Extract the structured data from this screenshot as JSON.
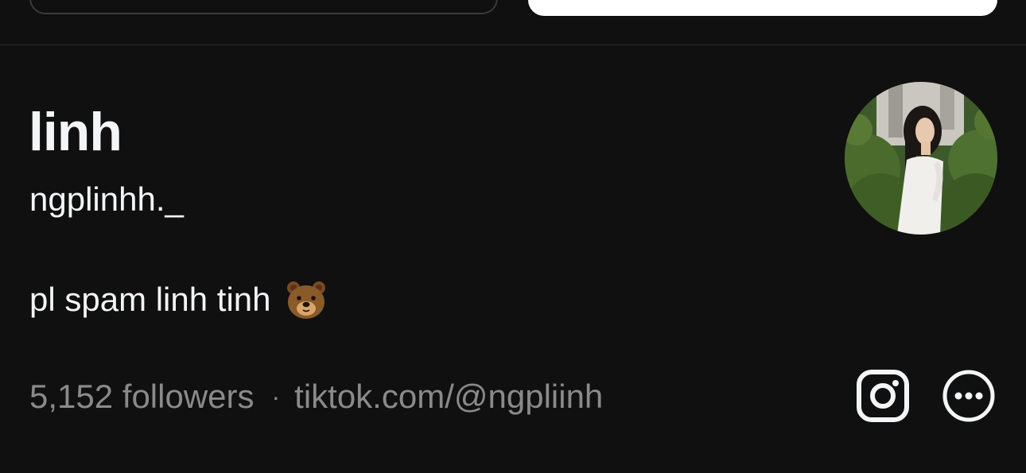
{
  "profile": {
    "display_name": "linh",
    "username": "ngplinhh._",
    "bio": "pl spam linh tinh",
    "bio_emoji": "bear-face",
    "followers": "5,152 followers",
    "separator": "·",
    "link": "tiktok.com/@ngpliinh"
  },
  "icons": {
    "instagram": "instagram-icon",
    "more": "more-options-icon"
  },
  "colors": {
    "background": "#101010",
    "primary_text": "#f3f5f7",
    "secondary_text": "#8a8a8a",
    "divider": "#2d2d2d"
  }
}
